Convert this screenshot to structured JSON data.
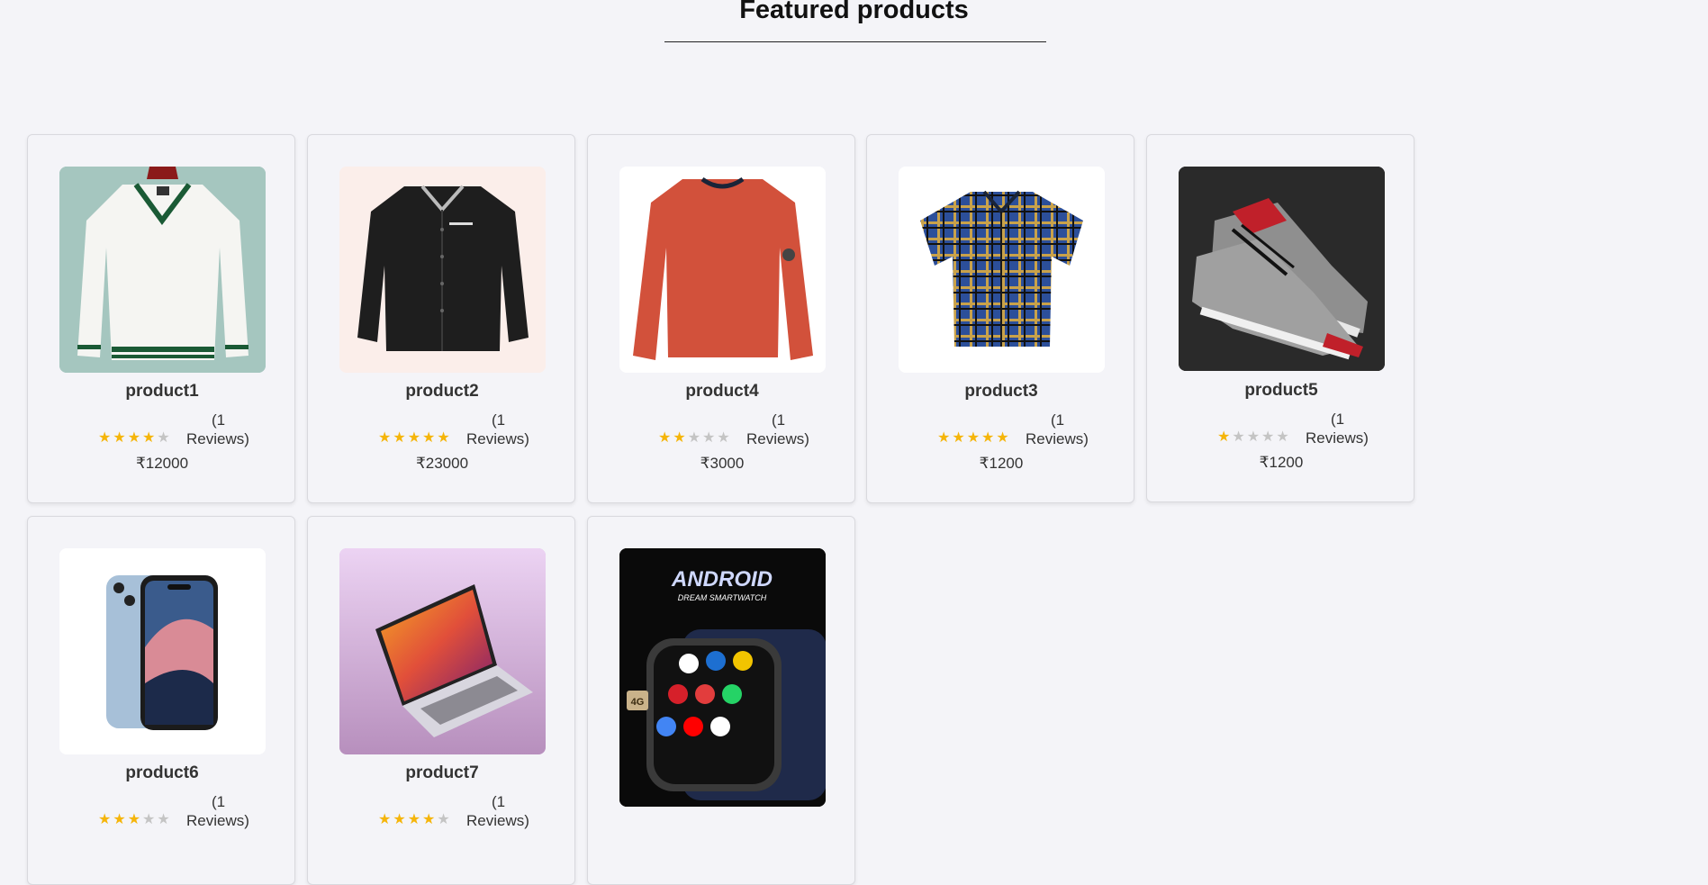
{
  "section": {
    "title": "Featured products"
  },
  "products": [
    {
      "name": "product1",
      "reviews_open": "(1",
      "reviews_close": "Reviews)",
      "rating": 4,
      "price": "₹12000",
      "image": "white-sweater"
    },
    {
      "name": "product2",
      "reviews_open": "(1",
      "reviews_close": "Reviews)",
      "rating": 5,
      "price": "₹23000",
      "image": "black-jacket"
    },
    {
      "name": "product4",
      "reviews_open": "(1",
      "reviews_close": "Reviews)",
      "rating": 2,
      "price": "₹3000",
      "image": "orange-sweater"
    },
    {
      "name": "product3",
      "reviews_open": "(1",
      "reviews_close": "Reviews)",
      "rating": 5,
      "price": "₹1200",
      "image": "plaid-shirt"
    },
    {
      "name": "product5",
      "reviews_open": "(1",
      "reviews_close": "Reviews)",
      "rating": 1,
      "price": "₹1200",
      "image": "sneakers"
    },
    {
      "name": "product6",
      "reviews_open": "(1",
      "reviews_close": "Reviews)",
      "rating": 3,
      "price": "",
      "image": "smartphone"
    },
    {
      "name": "product7",
      "reviews_open": "(1",
      "reviews_close": "Reviews)",
      "rating": 4,
      "price": "",
      "image": "laptop"
    },
    {
      "name": "",
      "reviews_open": "",
      "reviews_close": "",
      "rating": 0,
      "price": "",
      "image": "smartwatch",
      "image_text": {
        "headline": "ANDROID",
        "sub": "DREAM SMARTWATCH",
        "badge": "4G"
      }
    }
  ],
  "colors": {
    "star": "#f5b50a",
    "star_off": "#c4c4c4",
    "background": "#f4f4f8"
  }
}
